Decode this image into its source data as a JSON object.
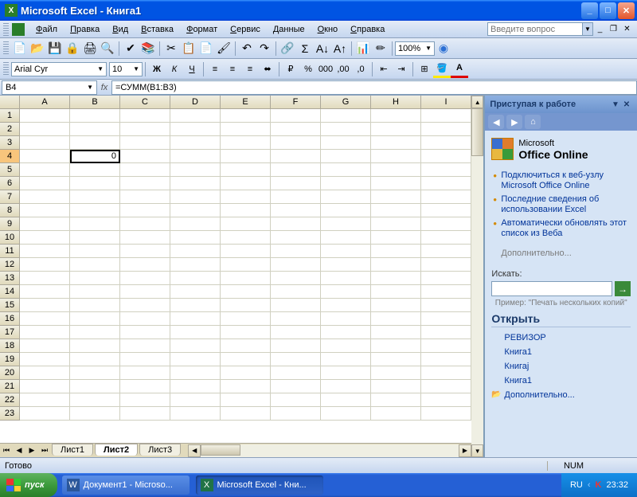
{
  "titlebar": {
    "title": "Microsoft Excel - Книга1"
  },
  "menu": {
    "items": [
      "Файл",
      "Правка",
      "Вид",
      "Вставка",
      "Формат",
      "Сервис",
      "Данные",
      "Окно",
      "Справка"
    ],
    "help_placeholder": "Введите вопрос"
  },
  "toolbar": {
    "zoom": "100%"
  },
  "format": {
    "font": "Arial Cyr",
    "size": "10"
  },
  "formulabar": {
    "name": "B4",
    "formula": "=СУММ(B1:B3)"
  },
  "grid": {
    "cols": [
      "A",
      "B",
      "C",
      "D",
      "E",
      "F",
      "G",
      "H",
      "I"
    ],
    "rows": 23,
    "active": {
      "row": 4,
      "col": "B",
      "value": "0"
    }
  },
  "sheets": {
    "tabs": [
      "Лист1",
      "Лист2",
      "Лист3"
    ],
    "active": 1
  },
  "taskpane": {
    "title": "Приступая к работе",
    "office_online": "Office Online",
    "office_prefix": "Microsoft",
    "links": [
      "Подключиться к веб-узлу Microsoft Office Online",
      "Последние сведения об использовании Excel",
      "Автоматически обновлять этот список из Веба"
    ],
    "more": "Дополнительно...",
    "search_label": "Искать:",
    "example": "Пример: \"Печать нескольких копий\"",
    "open_header": "Открыть",
    "recent": [
      "РЕВИЗОР",
      "Книга1",
      "Книгаj",
      "Книга1"
    ],
    "more_open": "Дополнительно..."
  },
  "status": {
    "ready": "Готово",
    "num": "NUM"
  },
  "taskbar": {
    "start": "пуск",
    "apps": [
      {
        "label": "Документ1 - Microso...",
        "icon": "W",
        "color": "#2b579a"
      },
      {
        "label": "Microsoft Excel - Кни...",
        "icon": "X",
        "color": "#217346"
      }
    ],
    "lang": "RU",
    "time": "23:32"
  }
}
